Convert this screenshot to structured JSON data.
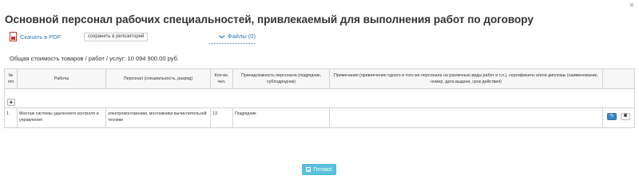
{
  "dialog": {
    "title": "Основной персонал рабочих специальностей, привлекаемый для выполнения работ по договору",
    "close_icon": "×"
  },
  "toolbar": {
    "pdf_label": "Скачать в PDF",
    "repo_label": "сохранить в репозиторий",
    "files_label": "Файлы (0)",
    "files_chevron": "❯"
  },
  "cost_text": "Общая стоимость товаров / работ / услуг: 10 094 900.00 руб.",
  "table": {
    "headers": [
      "№ п/п",
      "Работы",
      "Персонал (специальность, разряд)",
      "Кол-во, чел.",
      "Принадлежность персонала (подрядчик, субподрядчик)",
      "Примечания (привлечение одного и того же персонала на различные виды работ и т.п.), сертификаты и/или дипломы (наименование, номер, дата выдачи, срок действия)"
    ],
    "add_label": "+",
    "rows": [
      {
        "num": "1",
        "work": "Монтаж системы удаленного контроля и управления",
        "staff": "электромонтажники, монтажники вычислительной техники",
        "count": "13",
        "affiliation": "Подрядчик",
        "notes": ""
      }
    ],
    "edit_glyph": "✎",
    "delete_glyph": "✖"
  },
  "footer": {
    "ok_label": "Готово!"
  },
  "colors": {
    "link": "#2a7ab5",
    "primary": "#3a87c9",
    "info": "#5bc0de",
    "pdf_red": "#c9302c"
  }
}
